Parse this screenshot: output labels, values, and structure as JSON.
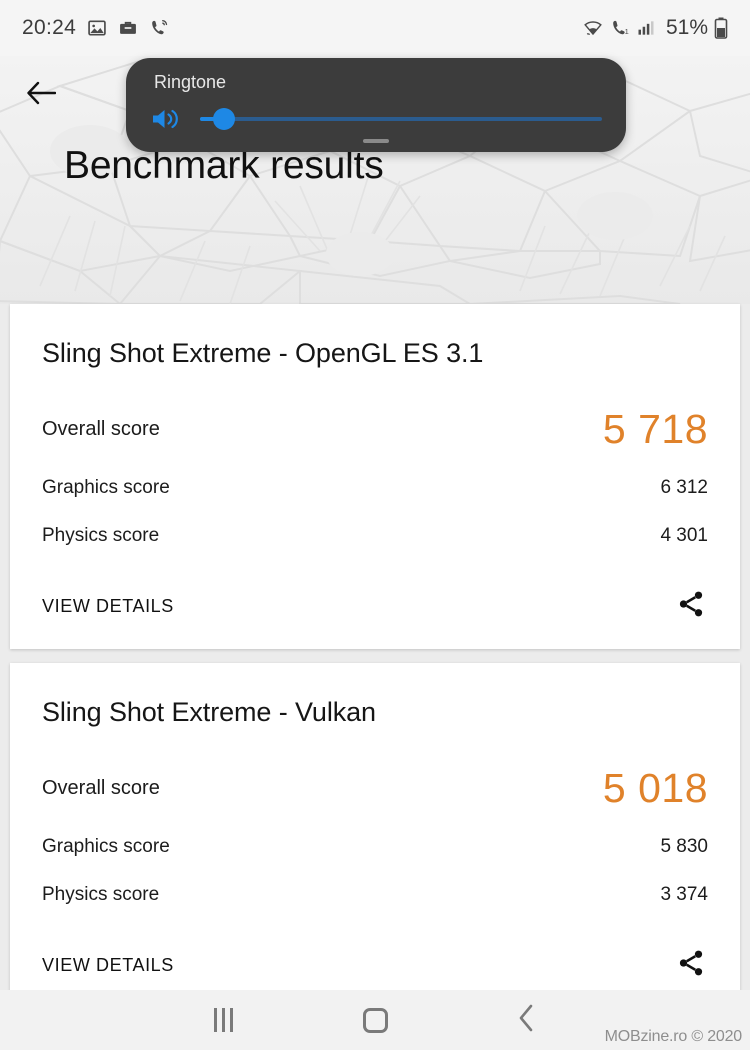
{
  "statusbar": {
    "time": "20:24",
    "battery_percent": "51%",
    "left_icons": [
      "image-icon",
      "briefcase-icon",
      "wifi-calling-icon"
    ],
    "right_icons": [
      "wifi-icon",
      "volte-call-icon",
      "signal-bars-icon",
      "battery-icon"
    ]
  },
  "header": {
    "title": "Benchmark results",
    "back_icon": "back-arrow-icon"
  },
  "volume_panel": {
    "label": "Ringtone",
    "speaker_icon": "volume-up-icon",
    "slider_percent": 6,
    "expand_handle": "expand-handle"
  },
  "cards": [
    {
      "title": "Sling Shot Extreme - OpenGL ES 3.1",
      "overall_label": "Overall score",
      "overall_value": "5 718",
      "rows": [
        {
          "label": "Graphics score",
          "value": "6 312"
        },
        {
          "label": "Physics score",
          "value": "4 301"
        }
      ],
      "view_details_label": "VIEW DETAILS",
      "share_icon": "share-icon"
    },
    {
      "title": "Sling Shot Extreme - Vulkan",
      "overall_label": "Overall score",
      "overall_value": "5 018",
      "rows": [
        {
          "label": "Graphics score",
          "value": "5 830"
        },
        {
          "label": "Physics score",
          "value": "3 374"
        }
      ],
      "view_details_label": "VIEW DETAILS",
      "share_icon": "share-icon"
    }
  ],
  "navbar": {
    "recents_icon": "recents-icon",
    "home_icon": "home-icon",
    "back_icon": "back-icon"
  },
  "watermark": "MOBzine.ro © 2020",
  "colors": {
    "accent_orange": "#e0822a",
    "slider_blue": "#1e88e5",
    "panel_dark": "#3c3c3c",
    "page_bg": "#ececec"
  }
}
